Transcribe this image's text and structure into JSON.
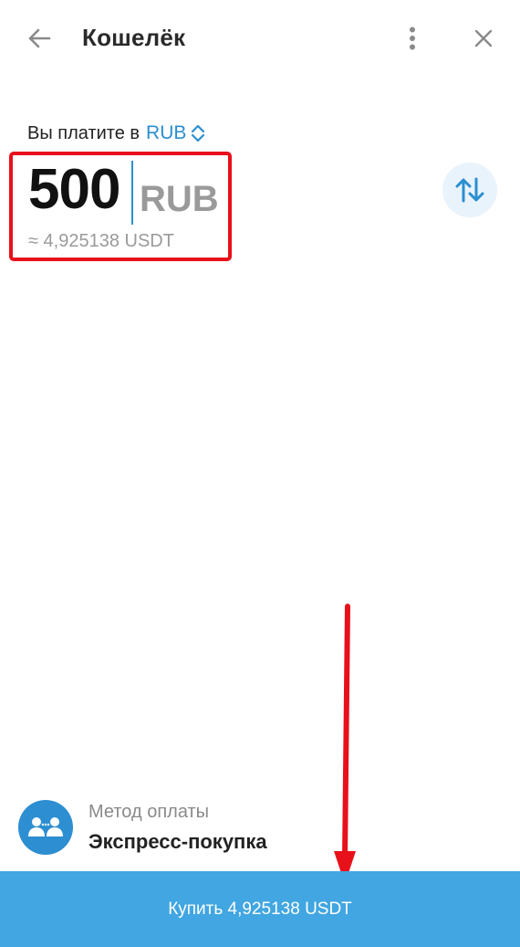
{
  "header": {
    "title": "Кошелёк",
    "icons": {
      "back": "arrow-left-icon",
      "menu": "more-vertical-icon",
      "close": "close-icon"
    }
  },
  "payment": {
    "label": "Вы платите в",
    "currency": "RUB",
    "currency_selector_icon": "chevron-up-down-icon",
    "amount": "500",
    "amount_currency": "RUB",
    "converted": "≈ 4,925138 USDT",
    "swap_icon": "swap-vertical-icon"
  },
  "method": {
    "caption": "Метод оплаты",
    "value": "Экспресс-покупка",
    "icon": "users-transfer-icon"
  },
  "buy_button": {
    "label": "Купить 4,925138 USDT"
  },
  "colors": {
    "accent": "#2a8fd0",
    "button": "#41a6e2",
    "highlight_annotation": "#e8101a"
  }
}
